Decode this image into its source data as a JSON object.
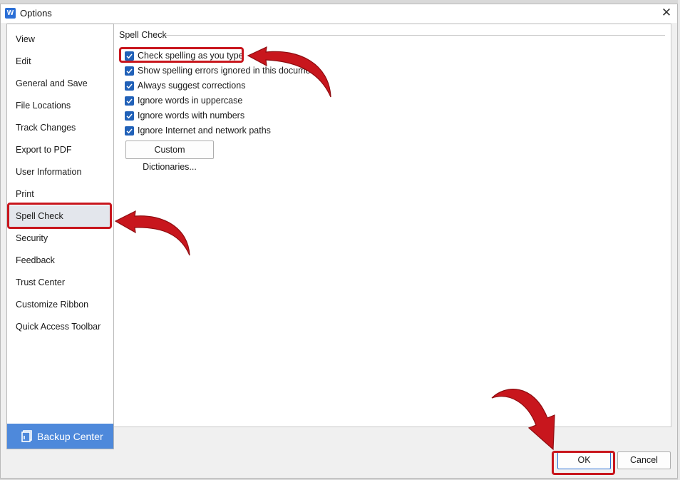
{
  "window": {
    "title": "Options",
    "app_icon_letter": "W"
  },
  "sidebar": {
    "items": [
      {
        "label": "View"
      },
      {
        "label": "Edit"
      },
      {
        "label": "General and Save"
      },
      {
        "label": "File Locations"
      },
      {
        "label": "Track Changes"
      },
      {
        "label": "Export to PDF"
      },
      {
        "label": "User Information"
      },
      {
        "label": "Print"
      },
      {
        "label": "Spell Check",
        "selected": true
      },
      {
        "label": "Security"
      },
      {
        "label": "Feedback"
      },
      {
        "label": "Trust Center"
      },
      {
        "label": "Customize Ribbon"
      },
      {
        "label": "Quick Access Toolbar"
      }
    ],
    "backup_center_label": "Backup Center"
  },
  "spell_check": {
    "group_title": "Spell Check",
    "options": [
      {
        "label": "Check spelling as you type",
        "checked": true
      },
      {
        "label": "Show spelling errors ignored in this document",
        "checked": true
      },
      {
        "label": "Always suggest corrections",
        "checked": true
      },
      {
        "label": "Ignore words in uppercase",
        "checked": true
      },
      {
        "label": "Ignore words with numbers",
        "checked": true
      },
      {
        "label": "Ignore Internet and network paths",
        "checked": true
      }
    ],
    "custom_dictionaries_label": "Custom Dictionaries..."
  },
  "footer": {
    "ok_label": "OK",
    "cancel_label": "Cancel"
  },
  "colors": {
    "accent": "#2161b8",
    "backup_center_bg": "#4e89db",
    "annotation_red": "#c8161d",
    "selected_bg": "#e3e6ec"
  },
  "icons": {
    "close": "close-icon",
    "checkmark": "checkmark-icon",
    "backup": "backup-icon",
    "annotation": "red-arrow-icon"
  }
}
